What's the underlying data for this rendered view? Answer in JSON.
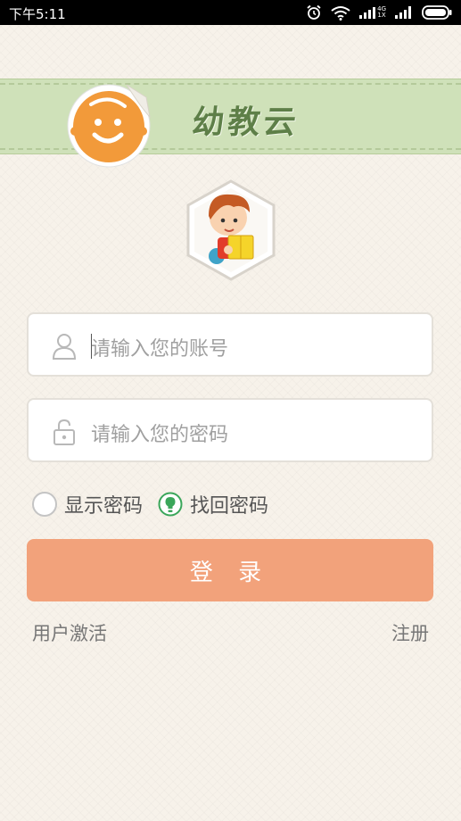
{
  "status_bar": {
    "time": "下午5:11",
    "network_label_top": "4G",
    "network_label_bottom": "1X"
  },
  "header": {
    "app_title": "幼教云"
  },
  "login_form": {
    "username_placeholder": "请输入您的账号",
    "password_placeholder": "请输入您的密码",
    "show_password_label": "显示密码",
    "find_password_label": "找回密码",
    "login_button_label": "登 录"
  },
  "footer_links": {
    "activate_label": "用户激活",
    "register_label": "注册"
  },
  "colors": {
    "banner": "#cfe1b9",
    "login_button": "#f2a27b",
    "logo_orange": "#f29a3a",
    "find_password_icon": "#3aa65a"
  }
}
